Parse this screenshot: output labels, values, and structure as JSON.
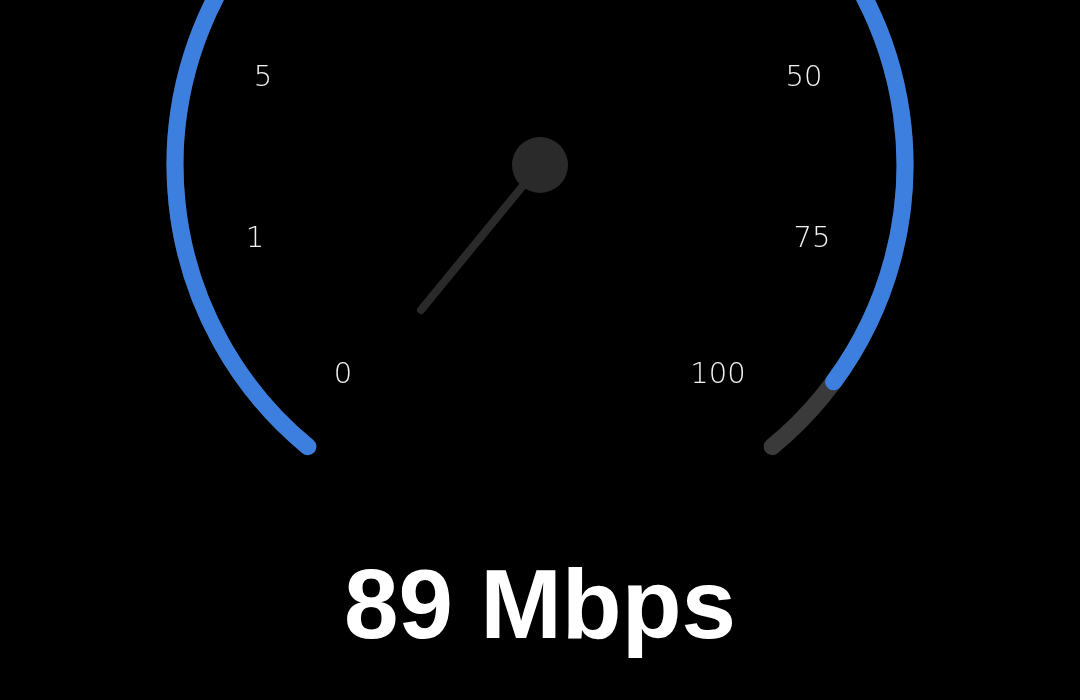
{
  "gauge": {
    "level": 0.95,
    "ticks": [
      "0",
      "1",
      "5",
      "50",
      "75",
      "100"
    ]
  },
  "speed": "89 Mbps"
}
